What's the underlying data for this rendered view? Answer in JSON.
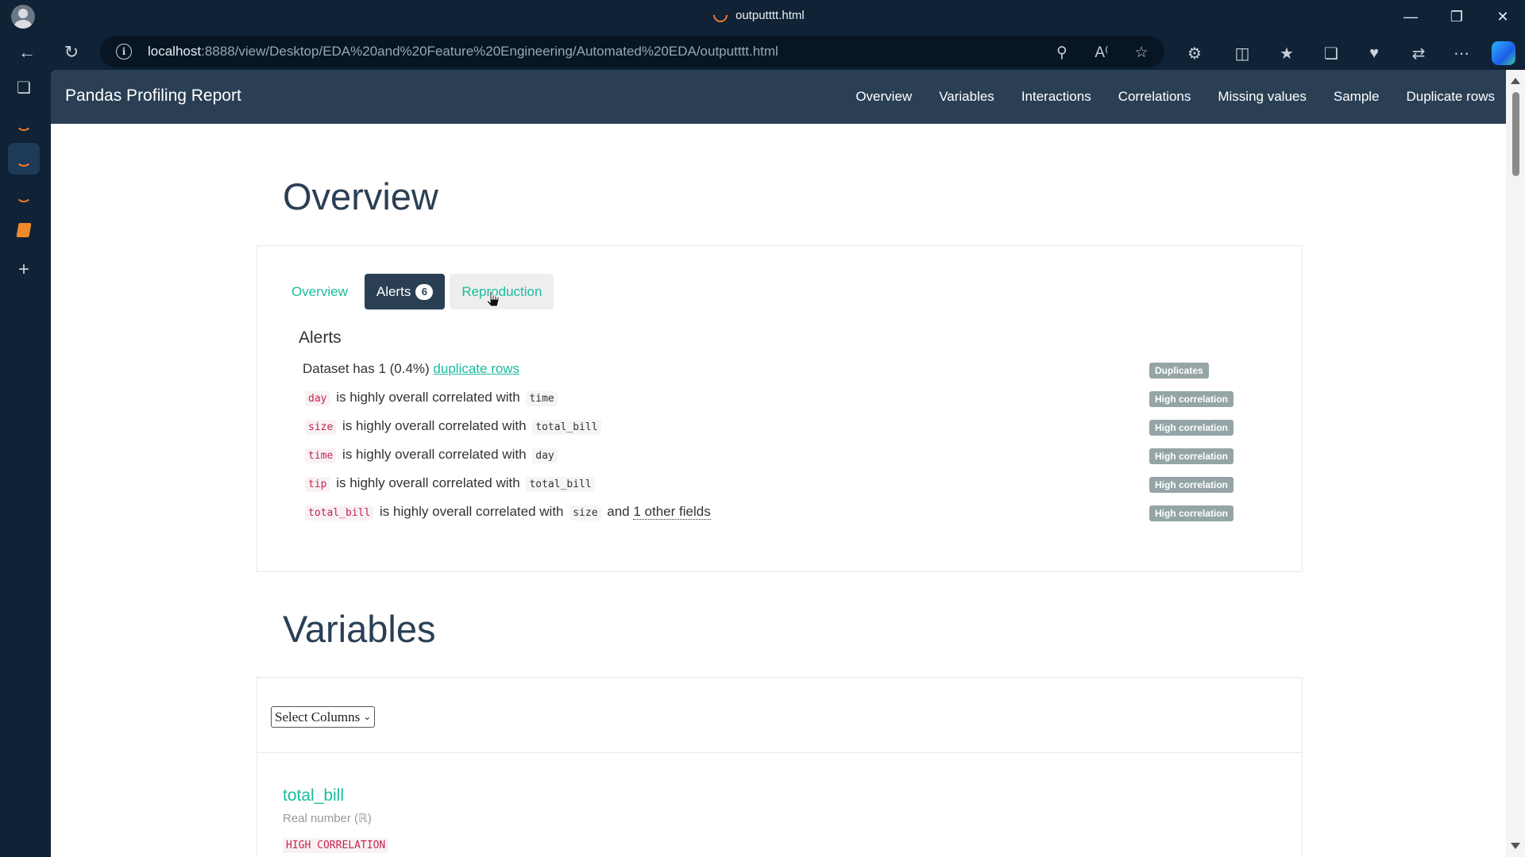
{
  "browser": {
    "tab_title": "outputttt.html",
    "url_host": "localhost",
    "url_rest": ":8888/view/Desktop/EDA%20and%20Feature%20Engineering/Automated%20EDA/outputttt.html"
  },
  "report": {
    "brand": "Pandas Profiling Report",
    "nav": [
      "Overview",
      "Variables",
      "Interactions",
      "Correlations",
      "Missing values",
      "Sample",
      "Duplicate rows"
    ]
  },
  "overview": {
    "heading": "Overview",
    "tabs": {
      "overview": "Overview",
      "alerts": "Alerts",
      "alerts_count": "6",
      "reproduction": "Reproduction"
    },
    "alerts_title": "Alerts",
    "alerts": [
      {
        "pre": "Dataset has 1 (0.4%) ",
        "link": "duplicate rows",
        "label": "Duplicates"
      },
      {
        "var": "day",
        "mid": " is highly overall correlated with ",
        "other": "time",
        "label": "High correlation"
      },
      {
        "var": "size",
        "mid": " is highly overall correlated with ",
        "other": "total_bill",
        "label": "High correlation"
      },
      {
        "var": "time",
        "mid": " is highly overall correlated with ",
        "other": "day",
        "label": "High correlation"
      },
      {
        "var": "tip",
        "mid": " is highly overall correlated with ",
        "other": "total_bill",
        "label": "High correlation"
      },
      {
        "var": "total_bill",
        "mid": " is highly overall correlated with ",
        "other": "size",
        "tail": " and ",
        "tail_link": "1 other fields",
        "label": "High correlation"
      }
    ]
  },
  "variables": {
    "heading": "Variables",
    "select_label": "Select Columns",
    "first_var": {
      "name": "total_bill",
      "type": "Real number (ℝ)",
      "badge": "HIGH CORRELATION"
    }
  }
}
